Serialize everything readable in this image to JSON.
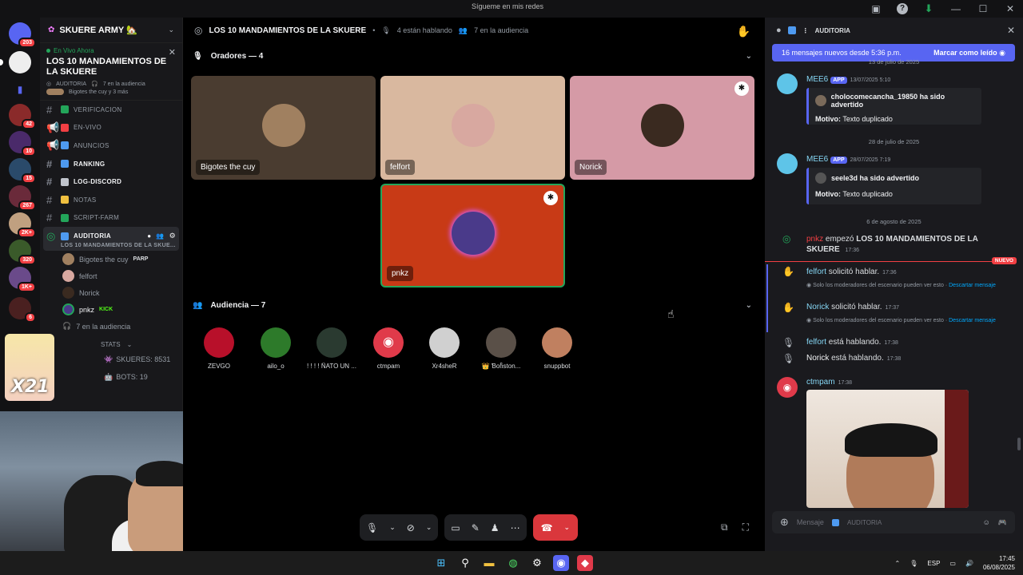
{
  "titlebar": {
    "center_text": "Sígueme en mis redes"
  },
  "rail": {
    "badges": [
      "203",
      "42",
      "10",
      "15",
      "267",
      "2K+",
      "320",
      "1K+",
      "6",
      "8"
    ]
  },
  "sidebar": {
    "server_name": "SKUERE ARMY 🏡",
    "live_tag": "En Vivo Ahora",
    "live_title": "LOS 10 MANDAMIENTOS DE LA SKUERE",
    "live_channel": "AUDITORIA",
    "live_audience": "7 en la audiencia",
    "live_speakers": "Bigotes the cuy y 3 más",
    "channels": [
      {
        "label": "VERIFICACION",
        "color": "#23a55a"
      },
      {
        "label": "EN-VIVO",
        "color": "#f23f43"
      },
      {
        "label": "ANUNCIOS",
        "color": "#4e9af0"
      },
      {
        "label": "RANKING",
        "color": "#4e9af0"
      },
      {
        "label": "LOG-DISCORD",
        "color": "#c0c4cc"
      },
      {
        "label": "NOTAS",
        "color": "#f0c040"
      },
      {
        "label": "SCRIPT-FARM",
        "color": "#23a55a"
      }
    ],
    "active_channel": "AUDITORIA",
    "active_sub": "LOS 10 MANDAMIENTOS DE LA SKUE...",
    "voice_users": [
      {
        "name": "Bigotes the cuy",
        "tag": "PARP"
      },
      {
        "name": "felfort",
        "tag": ""
      },
      {
        "name": "Norick",
        "tag": ""
      },
      {
        "name": "pnkz",
        "tag": "KICK"
      }
    ],
    "audience_line": "7 en la audiencia",
    "stats_head": "STATS",
    "stat_skueres": "SKUERES: 8531",
    "stat_bots": "BOTS: 19"
  },
  "overlay": {
    "sticker_text": "X21"
  },
  "stage": {
    "title": "LOS 10 MANDAMIENTOS DE LA SKUERE",
    "speaking": "4 están hablando",
    "audience": "7 en la audiencia",
    "speakers_label": "Oradores — 4",
    "audience_label": "Audiencia — 7",
    "speakers": [
      {
        "name": "Bigotes the cuy",
        "bg": "#4a3c30",
        "av": "#a08060"
      },
      {
        "name": "felfort",
        "bg": "#d9b89f",
        "av": "#d8a8a0"
      },
      {
        "name": "Norick",
        "bg": "#d59aa6",
        "av": "#3a2a20"
      },
      {
        "name": "pnkz",
        "bg": "#c83a16",
        "av": "#4a3a8a"
      }
    ],
    "audience_members": [
      {
        "name": "ZEVGO",
        "av": "#b8102a"
      },
      {
        "name": "ailo_o",
        "av": "#2d7a2a"
      },
      {
        "name": "! ! ! ! ÑATO UN ...",
        "av": "#2a3a30"
      },
      {
        "name": "ctmpam",
        "av": "#e03a4a"
      },
      {
        "name": "Xr4sheR",
        "av": "#d0d0d0"
      },
      {
        "name": "👑 Ɓoჩston...",
        "av": "#5a5048"
      },
      {
        "name": "snuppbot",
        "av": "#c08060"
      }
    ]
  },
  "chat": {
    "channel": "AUDITORIA",
    "new_messages": "16 mensajes nuevos desde 5:36 p.m.",
    "mark_read": "Marcar como leído",
    "date_top": "13 de julio de 2025",
    "msg1": {
      "author": "MEE6",
      "app": "APP",
      "time": "13/07/2025 5:10",
      "warned": "cholocomecancha_19850 ha sido advertido",
      "reason_label": "Motivo:",
      "reason": "Texto duplicado"
    },
    "date2": "28 de julio de 2025",
    "msg2": {
      "author": "MEE6",
      "app": "APP",
      "time": "28/07/2025 7:19",
      "warned": "seele3d ha sido advertido",
      "reason_label": "Motivo:",
      "reason": "Texto duplicado"
    },
    "date3": "6 de agosto de 2025",
    "stage_start": {
      "user": "pnkz",
      "text": "empezó",
      "event": "LOS 10 MANDAMIENTOS DE LA SKUERE",
      "time": "17:36"
    },
    "nuevo": "NUEVO",
    "req1": {
      "user": "felfort",
      "text": "solicitó hablar.",
      "time": "17:36"
    },
    "req2": {
      "user": "Norick",
      "text": "solicitó hablar.",
      "time": "17:37"
    },
    "mod_note": "Solo los moderadores del escenario pueden ver esto ·",
    "dismiss": "Descartar mensaje",
    "speak1": {
      "user": "felfort",
      "text": "está hablando.",
      "time": "17:38"
    },
    "speak2": {
      "user": "Norick",
      "text": "está hablando.",
      "time": "17:38"
    },
    "msg3": {
      "author": "ctmpam",
      "time": "17:38"
    },
    "input_placeholder": "Mensaje",
    "input_channel": "AUDITORIA"
  },
  "taskbar": {
    "lang": "ESP",
    "time": "17:45",
    "date": "06/08/2025"
  }
}
